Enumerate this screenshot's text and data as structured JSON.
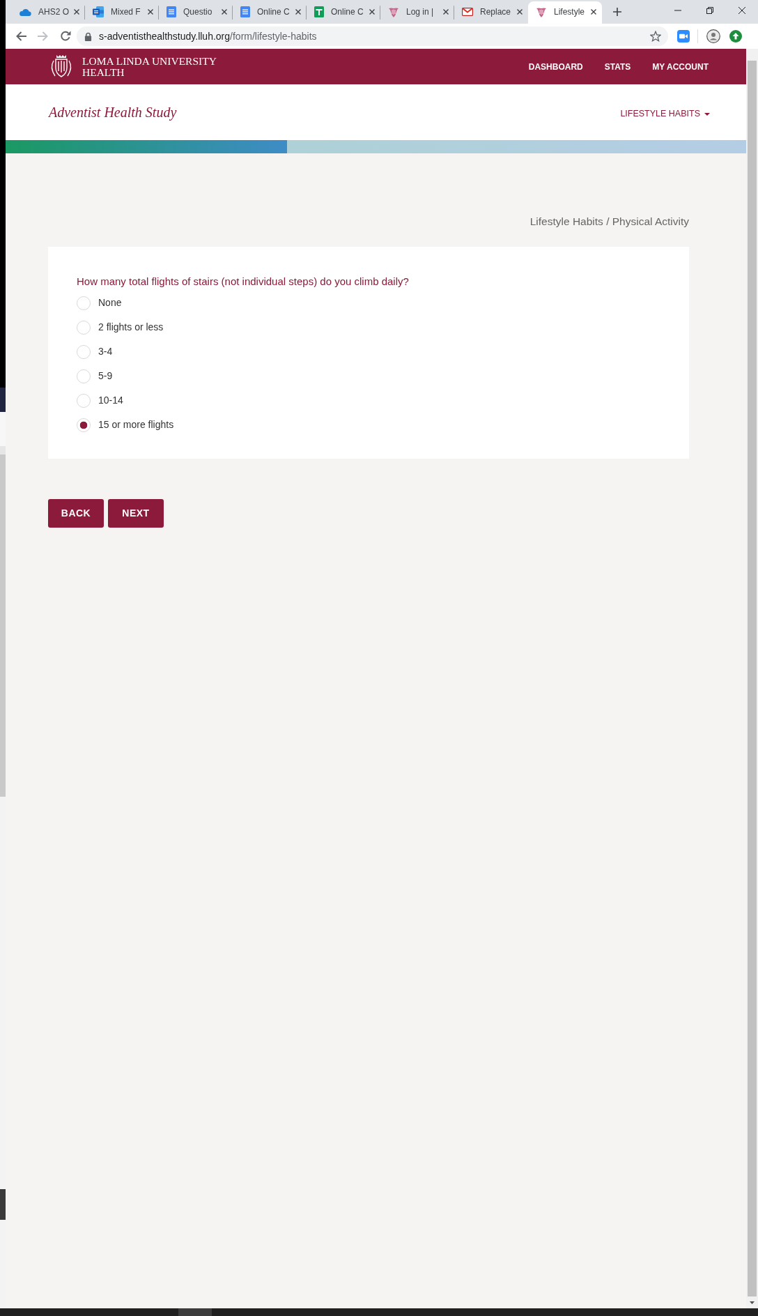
{
  "browser": {
    "tabs": [
      {
        "title": "AHS2 O",
        "kind": "cloud",
        "selected": false
      },
      {
        "title": "Mixed F",
        "kind": "word",
        "selected": false
      },
      {
        "title": "Questio",
        "kind": "doc",
        "selected": false
      },
      {
        "title": "Online C",
        "kind": "doc",
        "selected": false
      },
      {
        "title": "Online C",
        "kind": "sheet",
        "selected": false
      },
      {
        "title": "Log in |",
        "kind": "crest",
        "selected": false
      },
      {
        "title": "Replace",
        "kind": "mail",
        "selected": false
      },
      {
        "title": "Lifestyle",
        "kind": "crest",
        "selected": true
      }
    ],
    "nav_buttons": [
      {
        "kind": "back",
        "disabled": false
      },
      {
        "kind": "forward",
        "disabled": true
      },
      {
        "kind": "reload",
        "disabled": false
      }
    ],
    "address_bar": {
      "host": "s-adventisthealthstudy.lluh.org",
      "path": "/form/lifestyle-habits"
    }
  },
  "header": {
    "logo_lines": [
      "LOMA LINDA UNIVERSITY",
      "HEALTH"
    ],
    "nav": [
      "DASHBOARD",
      "STATS",
      "MY ACCOUNT"
    ]
  },
  "subheader": {
    "title": "Adventist Health Study",
    "menu": "LIFESTYLE HABITS"
  },
  "progress": {
    "level": 0.38
  },
  "breadcrumb": "Lifestyle Habits / Physical Activity",
  "question": {
    "text": "How many total flights of stairs (not individual steps) do you climb daily?",
    "options": [
      {
        "label": "None",
        "selected": false
      },
      {
        "label": "2 flights or less",
        "selected": false
      },
      {
        "label": "3-4",
        "selected": false
      },
      {
        "label": "5-9",
        "selected": false
      },
      {
        "label": "10-14",
        "selected": false
      },
      {
        "label": "15 or more flights",
        "selected": true
      }
    ]
  },
  "buttons": [
    "BACK",
    "NEXT"
  ]
}
